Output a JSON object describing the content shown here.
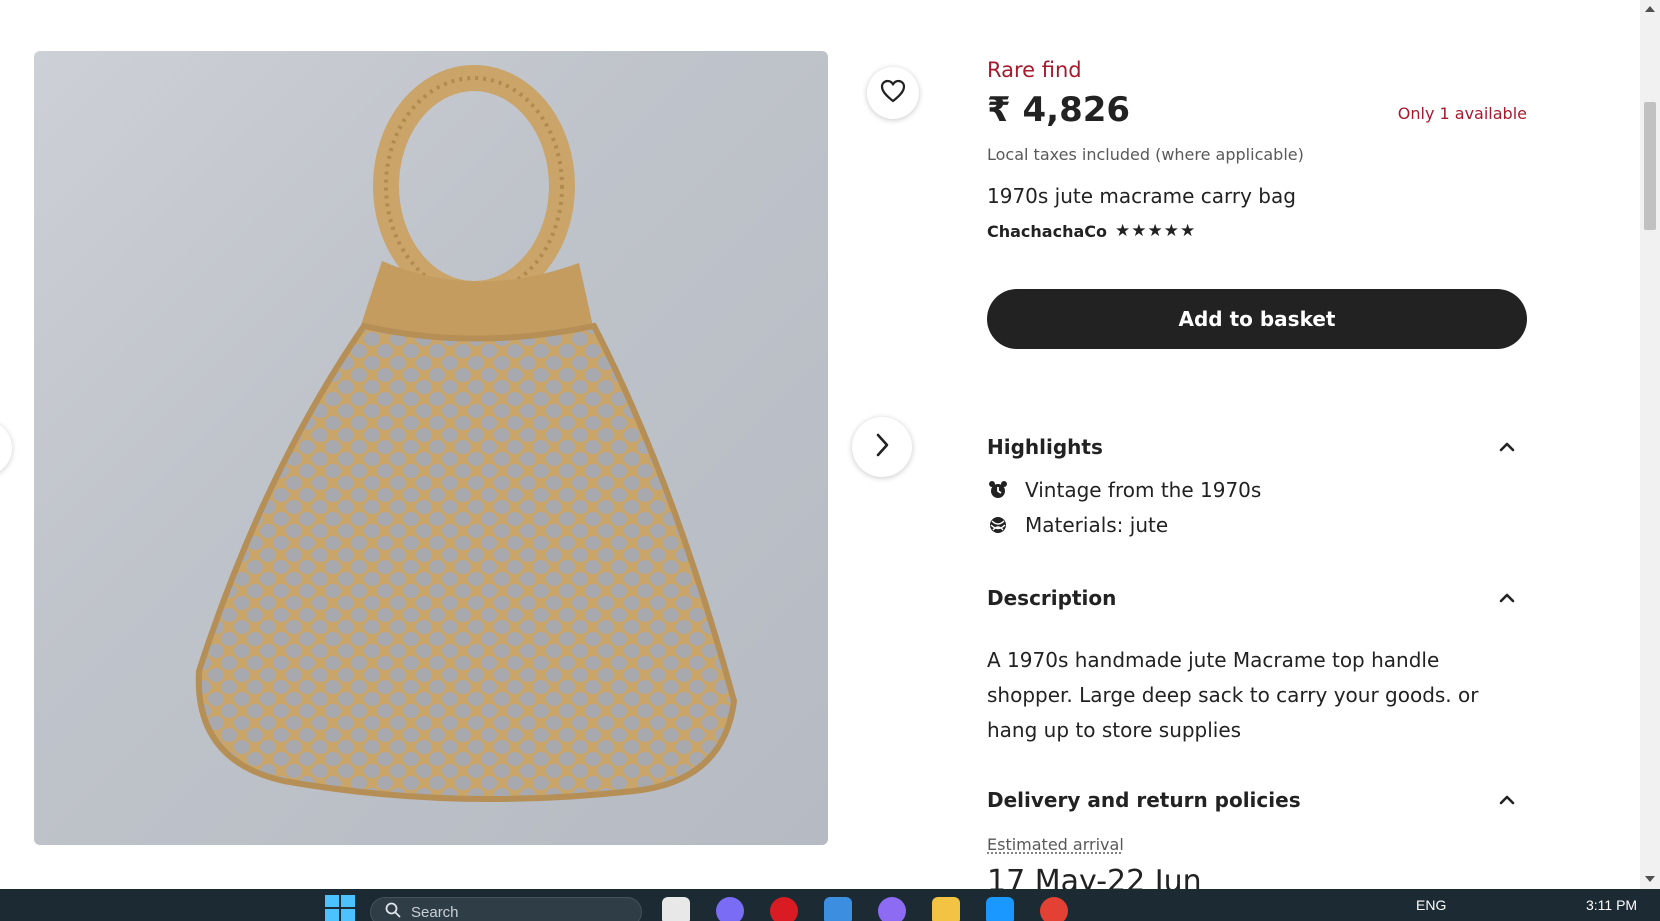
{
  "gallery": {
    "favorite_icon": "heart-icon",
    "next_icon": "chevron-right-icon"
  },
  "product": {
    "rare_label": "Rare find",
    "price": "₹ 4,826",
    "availability": "Only 1 available",
    "tax_note": "Local taxes included (where applicable)",
    "title": "1970s jute macrame carry bag",
    "shop_name": "ChachachaCo",
    "rating_stars": "★★★★★",
    "rating": 5,
    "add_to_basket": "Add to basket"
  },
  "highlights": {
    "heading": "Highlights",
    "items": [
      {
        "icon": "alarm-clock-icon",
        "label": "Vintage from the 1970s"
      },
      {
        "icon": "yarn-ball-icon",
        "label": "Materials: jute"
      }
    ]
  },
  "description": {
    "heading": "Description",
    "body": "A 1970s handmade jute Macrame top handle shopper. Large deep sack to carry your goods. or hang up to store supplies"
  },
  "delivery": {
    "heading": "Delivery and return policies",
    "estimated_label": "Estimated arrival",
    "arrival_dates": "17 May-22 Jun"
  },
  "taskbar": {
    "search_placeholder": "Search",
    "language": "ENG",
    "time": "3:11 PM"
  },
  "colors": {
    "accent_red": "#a61a2e",
    "button_dark": "#222222",
    "taskbar_bg": "#1c2a33"
  }
}
